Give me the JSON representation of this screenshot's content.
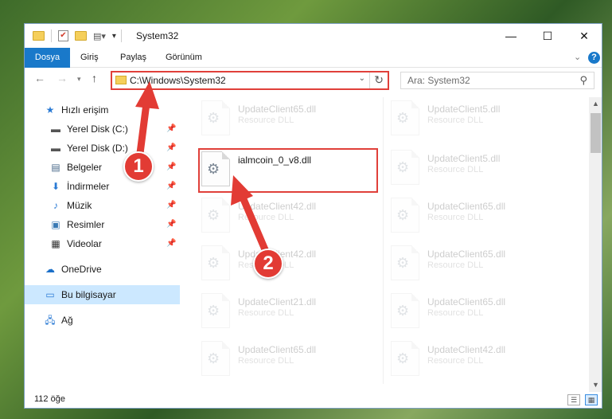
{
  "window": {
    "title": "System32",
    "buttons": {
      "minimize": "—",
      "maximize": "☐",
      "close": "✕"
    }
  },
  "ribbon": {
    "tabs": [
      "Dosya",
      "Giriş",
      "Paylaş",
      "Görünüm"
    ],
    "help": "?"
  },
  "nav": {
    "address": "C:\\Windows\\System32",
    "search_placeholder": "Ara: System32"
  },
  "sidebar": {
    "quick_access": "Hızlı erişim",
    "items": [
      {
        "label": "Yerel Disk (C:)",
        "icon": "drive-icon"
      },
      {
        "label": "Yerel Disk (D:)",
        "icon": "drive-icon"
      },
      {
        "label": "Belgeler",
        "icon": "documents-icon"
      },
      {
        "label": "İndirmeler",
        "icon": "download-icon"
      },
      {
        "label": "Müzik",
        "icon": "music-icon"
      },
      {
        "label": "Resimler",
        "icon": "pictures-icon"
      },
      {
        "label": "Videolar",
        "icon": "videos-icon"
      }
    ],
    "onedrive": "OneDrive",
    "this_pc": "Bu bilgisayar",
    "network": "Ağ"
  },
  "files": {
    "col1": [
      {
        "name": "UpdateClient65.dll",
        "type": "Resource DLL"
      },
      {
        "name": "ialmcoin_0_v8.dll",
        "type": ""
      },
      {
        "name": "UpdateClient42.dll",
        "type": "Resource DLL"
      },
      {
        "name": "UpdateClient42.dll",
        "type": "Resource DLL"
      },
      {
        "name": "UpdateClient21.dll",
        "type": "Resource DLL"
      },
      {
        "name": "UpdateClient65.dll",
        "type": "Resource DLL"
      }
    ],
    "col2": [
      {
        "name": "UpdateClient5.dll",
        "type": "Resource DLL"
      },
      {
        "name": "UpdateClient5.dll",
        "type": "Resource DLL"
      },
      {
        "name": "UpdateClient65.dll",
        "type": "Resource DLL"
      },
      {
        "name": "UpdateClient65.dll",
        "type": "Resource DLL"
      },
      {
        "name": "UpdateClient65.dll",
        "type": "Resource DLL"
      },
      {
        "name": "UpdateClient42.dll",
        "type": "Resource DLL"
      }
    ]
  },
  "status": {
    "item_count": "112 öğe"
  },
  "annotations": {
    "step1": "1",
    "step2": "2",
    "accent": "#e23b34"
  }
}
